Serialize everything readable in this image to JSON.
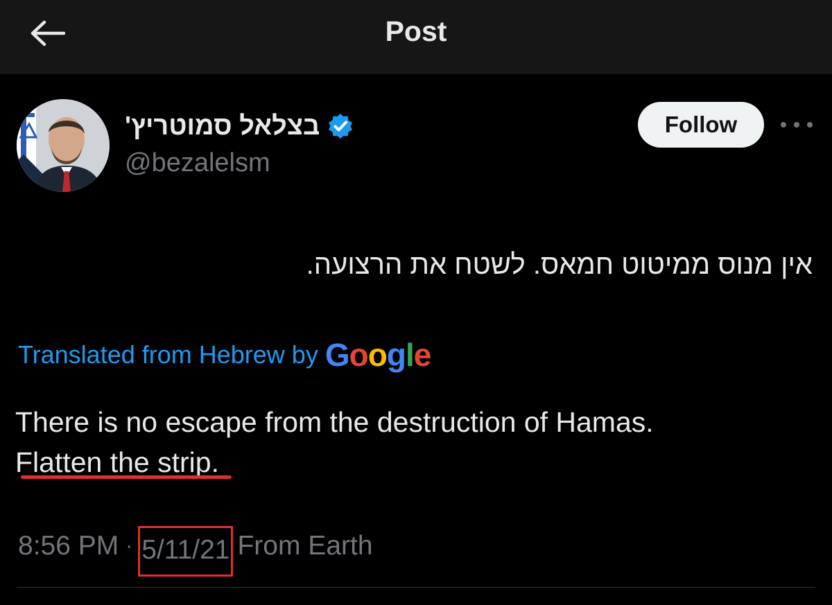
{
  "header": {
    "title": "Post",
    "back_icon": "arrow-left-icon"
  },
  "author": {
    "display_name": "בצלאל סמוטריץ'",
    "handle": "@bezalelsm",
    "verified_icon": "verified-badge-icon",
    "verified_color": "#1d9bf0",
    "follow_label": "Follow",
    "more_icon": "more-horizontal-icon"
  },
  "post": {
    "original_text": "אין מנוס ממיטוט חמאס. לשטח את הרצועה.",
    "translated_by": "Translated from Hebrew by",
    "translator_logo": "Google",
    "translation_line1": "There is no escape from the destruction of Hamas.",
    "translation_highlight": "Flatten the strip",
    "translation_end": ".",
    "time": "8:56 PM",
    "separator": "·",
    "date": "5/11/21",
    "source": "From Earth"
  },
  "colors": {
    "background": "#000000",
    "header_bg": "#161616",
    "text": "#e7e9ea",
    "muted": "#71767b",
    "link": "#1d9bf0",
    "annotation_red": "#e0302a"
  }
}
